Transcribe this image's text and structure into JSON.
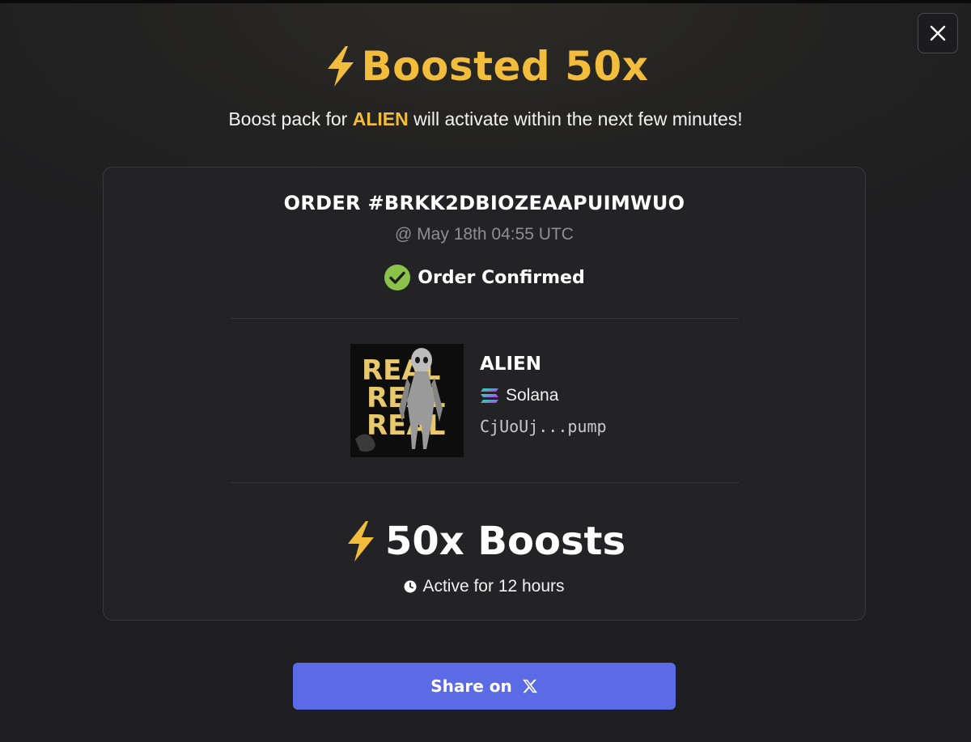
{
  "modal": {
    "close_icon": "close-icon",
    "title_icon": "lightning-bolt-icon",
    "title": "Boosted 50x",
    "subtitle_prefix": "Boost pack for ",
    "subtitle_token": "ALIEN",
    "subtitle_suffix": " will activate within the next few minutes!",
    "accent_color": "#f2bd3d"
  },
  "order": {
    "id_label": "ORDER #BRKK2DBIOZEAAPUIMWUO",
    "timestamp": "@ May 18th 04:55 UTC",
    "status_icon": "check-circle-icon",
    "status": "Order Confirmed",
    "status_color": "#8bc34a"
  },
  "token": {
    "name": "ALIEN",
    "chain_icon": "solana-icon",
    "chain": "Solana",
    "address": "CjUoUj...pump",
    "image_text": [
      "REAL",
      "REAL",
      "REAL"
    ]
  },
  "boost": {
    "icon": "lightning-bolt-icon",
    "label": "50x Boosts",
    "duration_icon": "clock-icon",
    "duration": "Active for 12 hours"
  },
  "share": {
    "label": "Share on",
    "icon": "x-logo-icon",
    "color": "#5b6be6"
  }
}
